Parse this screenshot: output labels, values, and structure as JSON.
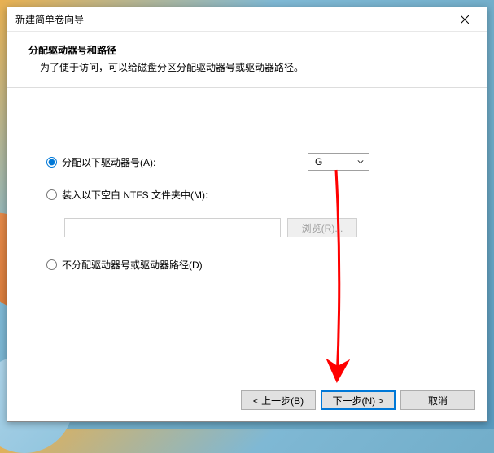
{
  "window": {
    "title": "新建简单卷向导"
  },
  "header": {
    "title": "分配驱动器号和路径",
    "description": "为了便于访问，可以给磁盘分区分配驱动器号或驱动器路径。"
  },
  "options": {
    "assign": {
      "label": "分配以下驱动器号(A):",
      "selected_drive": "G"
    },
    "mount": {
      "label": "装入以下空白 NTFS 文件夹中(M):",
      "path_value": "",
      "browse_label": "浏览(R)..."
    },
    "none": {
      "label": "不分配驱动器号或驱动器路径(D)"
    }
  },
  "footer": {
    "back": "< 上一步(B)",
    "next": "下一步(N) >",
    "cancel": "取消"
  }
}
